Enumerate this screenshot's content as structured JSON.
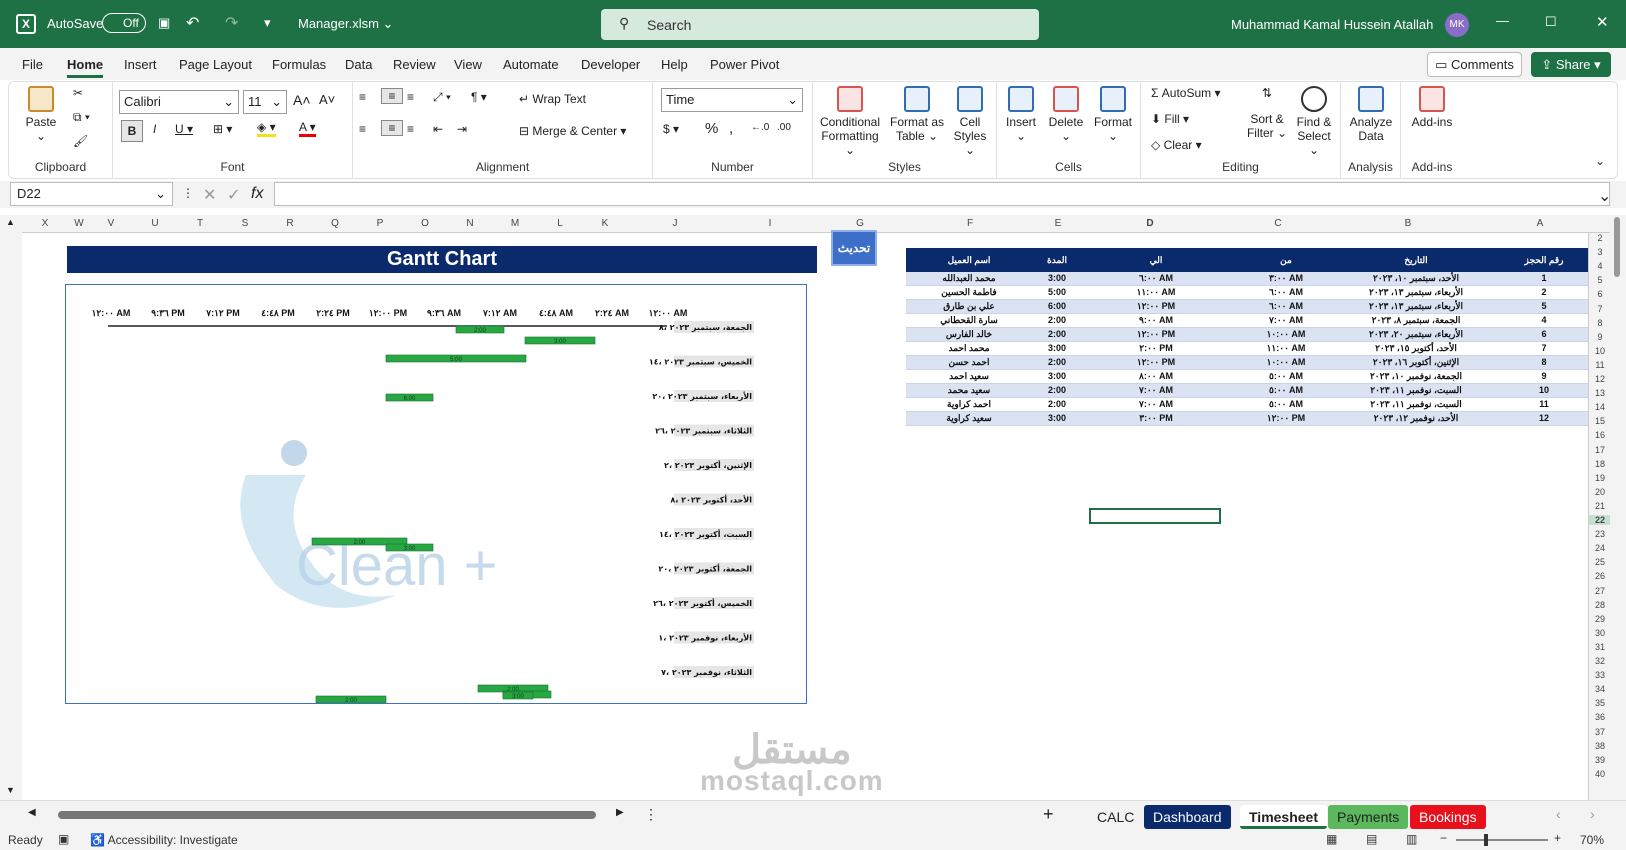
{
  "titlebar": {
    "autosave_label": "AutoSave",
    "autosave_state": "Off",
    "filename": "Manager.xlsm",
    "search_placeholder": "Search",
    "user_name": "Muhammad Kamal Hussein Atallah",
    "user_initials": "MK"
  },
  "menu": {
    "items": [
      "File",
      "Home",
      "Insert",
      "Page Layout",
      "Formulas",
      "Data",
      "Review",
      "View",
      "Automate",
      "Developer",
      "Help",
      "Power Pivot"
    ],
    "comments_label": "Comments",
    "share_label": "Share"
  },
  "ribbon": {
    "paste": "Paste",
    "clipboard": "Clipboard",
    "font_name": "Calibri",
    "font_size": "11",
    "font": "Font",
    "wrap_text": "Wrap Text",
    "merge_center": "Merge & Center",
    "alignment": "Alignment",
    "number_format": "Time",
    "number": "Number",
    "conditional_formatting": "Conditional Formatting",
    "format_as_table": "Format as Table",
    "cell_styles": "Cell Styles",
    "styles": "Styles",
    "insert": "Insert",
    "delete": "Delete",
    "format": "Format",
    "cells": "Cells",
    "autosum": "AutoSum",
    "fill": "Fill",
    "clear": "Clear",
    "sort_filter": "Sort & Filter",
    "find_select": "Find & Select",
    "editing": "Editing",
    "analyze_data": "Analyze Data",
    "analysis": "Analysis",
    "add_ins": "Add-ins",
    "add_ins_group": "Add-ins"
  },
  "formula_bar": {
    "name_box": "D22",
    "formula": ""
  },
  "columns": [
    "X",
    "W",
    "V",
    "U",
    "T",
    "S",
    "R",
    "Q",
    "P",
    "O",
    "N",
    "M",
    "L",
    "K",
    "J",
    "I",
    "G",
    "F",
    "E",
    "D",
    "C",
    "B",
    "A"
  ],
  "rows": [
    "2",
    "3",
    "4",
    "5",
    "6",
    "7",
    "8",
    "9",
    "10",
    "11",
    "12",
    "13",
    "14",
    "15",
    "16",
    "17",
    "18",
    "19",
    "20",
    "21",
    "22",
    "23",
    "24",
    "25",
    "26",
    "27",
    "28",
    "29",
    "30",
    "31",
    "32",
    "33",
    "34",
    "35",
    "36",
    "37",
    "38",
    "39",
    "40"
  ],
  "gantt": {
    "title": "Gantt Chart",
    "update_button": "تحديث",
    "time_axis": [
      "١٢:٠٠ AM",
      "٩:٣٦ PM",
      "٧:١٢ PM",
      "٤:٤٨ PM",
      "٢:٢٤ PM",
      "١٢:٠٠ PM",
      "٩:٣٦ AM",
      "٧:١٢ AM",
      "٤:٤٨ AM",
      "٢:٢٤ AM",
      "١٢:٠٠ AM"
    ],
    "date_labels": [
      "الجمعة، سبتمبر ٢٠٢٣ ،٨",
      "الخميس، سبتمبر ٢٠٢٣ ،١٤",
      "الأربعاء، سبتمبر ٢٠٢٣ ،٢٠",
      "الثلاثاء، سبتمبر ٢٠٢٣ ،٢٦",
      "الإثنين، أكتوبر ٢٠٢٣ ،٢",
      "الأحد، أكتوبر ٢٠٢٣ ،٨",
      "السبت، أكتوبر ٢٠٢٣ ،١٤",
      "الجمعة، أكتوبر ٢٠٢٣ ،٢٠",
      "الخميس، أكتوبر ٢٠٢٣ ،٢٦",
      "الأربعاء، نوفمبر ٢٠٢٣ ،١",
      "الثلاثاء، نوفمبر ٢٠٢٣ ،٧"
    ],
    "bar_labels": [
      "2:00",
      "3:00",
      "5:00",
      "6:00",
      "2:00",
      "3:00",
      "2:00",
      "3:00",
      "2:00",
      "3:00"
    ],
    "logo_text": "Clean +"
  },
  "table": {
    "headers": [
      "رقم الحجز",
      "التاريخ",
      "من",
      "الي",
      "المدة",
      "اسم العميل"
    ],
    "rows": [
      [
        "1",
        "الأحد، سبتمبر ١٠، ٢٠٢٣",
        "٣:٠٠ AM",
        "٦:٠٠ AM",
        "3:00",
        "محمد العبدالله"
      ],
      [
        "2",
        "الأربعاء، سبتمبر ١٣، ٢٠٢٣",
        "٦:٠٠ AM",
        "١١:٠٠ AM",
        "5:00",
        "فاطمة الحسين"
      ],
      [
        "5",
        "الأربعاء، سبتمبر ١٣، ٢٠٢٣",
        "٦:٠٠ AM",
        "١٢:٠٠ PM",
        "6:00",
        "علي بن طارق"
      ],
      [
        "4",
        "الجمعة، سبتمبر ٨، ٢٠٢٣",
        "٧:٠٠ AM",
        "٩:٠٠ AM",
        "2:00",
        "سارة القحطاني"
      ],
      [
        "6",
        "الأربعاء، سبتمبر ٢٠، ٢٠٢٣",
        "١٠:٠٠ AM",
        "١٢:٠٠ PM",
        "2:00",
        "خالد الفارس"
      ],
      [
        "7",
        "الأحد، أكتوبر ١٥، ٢٠٢٣",
        "١١:٠٠ AM",
        "٢:٠٠ PM",
        "3:00",
        "محمد احمد"
      ],
      [
        "8",
        "الإثنين، أكتوبر ١٦، ٢٠٢٣",
        "١٠:٠٠ AM",
        "١٢:٠٠ PM",
        "2:00",
        "احمد حسن"
      ],
      [
        "9",
        "الجمعة، نوفمبر ١٠، ٢٠٢٣",
        "٥:٠٠ AM",
        "٨:٠٠ AM",
        "3:00",
        "سعيد احمد"
      ],
      [
        "10",
        "السبت، نوفمبر ١١، ٢٠٢٣",
        "٥:٠٠ AM",
        "٧:٠٠ AM",
        "2:00",
        "سعيد محمد"
      ],
      [
        "11",
        "السبت، نوفمبر ١١، ٢٠٢٣",
        "٥:٠٠ AM",
        "٧:٠٠ AM",
        "2:00",
        "احمد كراوية"
      ],
      [
        "12",
        "الأحد، نوفمبر ١٢، ٢٠٢٣",
        "١٢:٠٠ PM",
        "٣:٠٠ PM",
        "3:00",
        "سعيد كراوية"
      ]
    ]
  },
  "sheet_tabs": [
    {
      "label": "CALC",
      "bg": "transparent",
      "color": "#222"
    },
    {
      "label": "Dashboard",
      "bg": "#0a2a6b",
      "color": "#ffffff"
    },
    {
      "label": "Timesheet",
      "bg": "#ffffff",
      "color": "#222"
    },
    {
      "label": "Payments",
      "bg": "#5cb85c",
      "color": "#222"
    },
    {
      "label": "Bookings",
      "bg": "#e8101a",
      "color": "#ffffff"
    }
  ],
  "status": {
    "ready": "Ready",
    "accessibility": "Accessibility: Investigate",
    "zoom": "70%"
  },
  "watermark": {
    "line1": "مستقل",
    "line2": "mostaql.com"
  },
  "colors": {
    "excel_green": "#1e7145",
    "header_navy": "#0a2a6b",
    "row_band": "#dbe3f3",
    "bar_green": "#27a844"
  }
}
